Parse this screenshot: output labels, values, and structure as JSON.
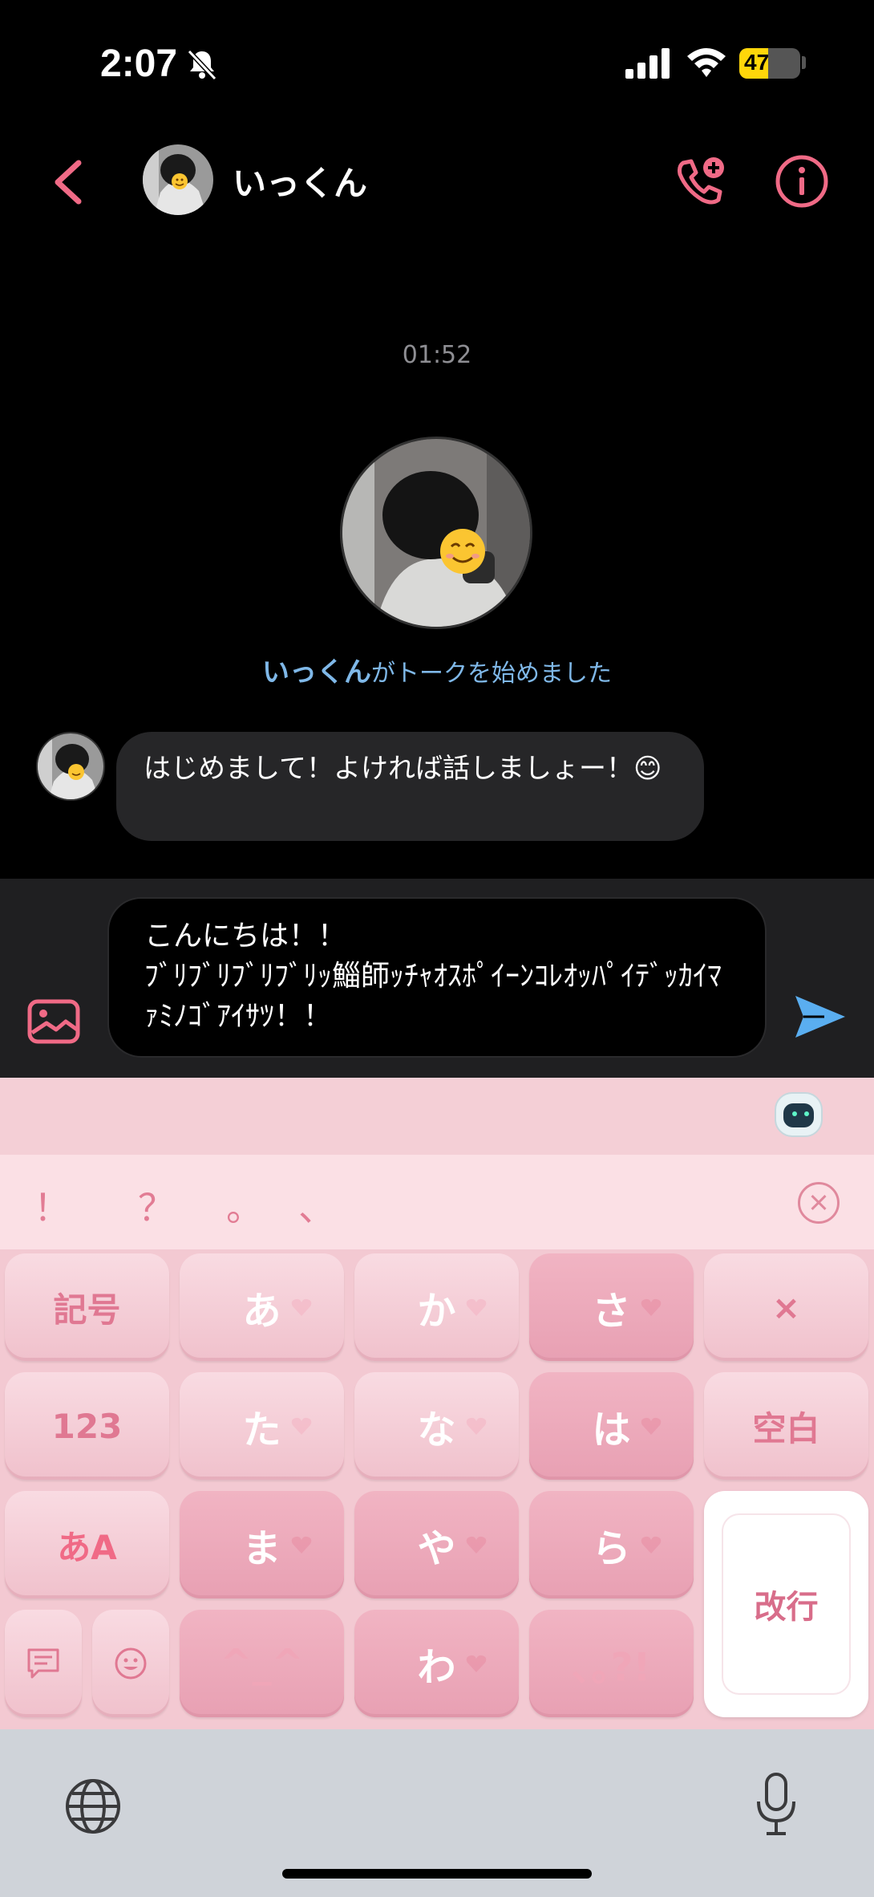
{
  "status_bar": {
    "time": "2:07",
    "battery": "47",
    "battery_level": 0.47
  },
  "header": {
    "contact_name": "いっくん"
  },
  "chat": {
    "timestamp": "01:52",
    "started_name": "いっくん",
    "started_suffix": "がトークを始めました",
    "message": "はじめまして！よければ話しましょー！😊"
  },
  "composer": {
    "text": "こんにちは！！\nﾌﾞﾘﾌﾞﾘﾌﾞﾘﾌﾞﾘｯ鯔師ｯﾁｬｵｽﾎﾟｲｰﾝｺﾚｵｯﾊﾟｲﾃﾞｯｶｲﾏｧﾐﾉｺﾞｱｲｻﾂ！！"
  },
  "keyboard": {
    "punct": [
      "！",
      "？",
      "。",
      "、"
    ],
    "rows": [
      [
        "記号",
        "あ",
        "か",
        "さ",
        "×"
      ],
      [
        "123",
        "た",
        "な",
        "は",
        "空白"
      ],
      [
        "あA",
        "ま",
        "や",
        "ら",
        "改行"
      ],
      [
        "^_^",
        "わ",
        "､｡?!"
      ]
    ]
  },
  "colors": {
    "accent": "#f06a86",
    "link": "#7fb8e8",
    "keyboard": "#f3c9d2"
  }
}
